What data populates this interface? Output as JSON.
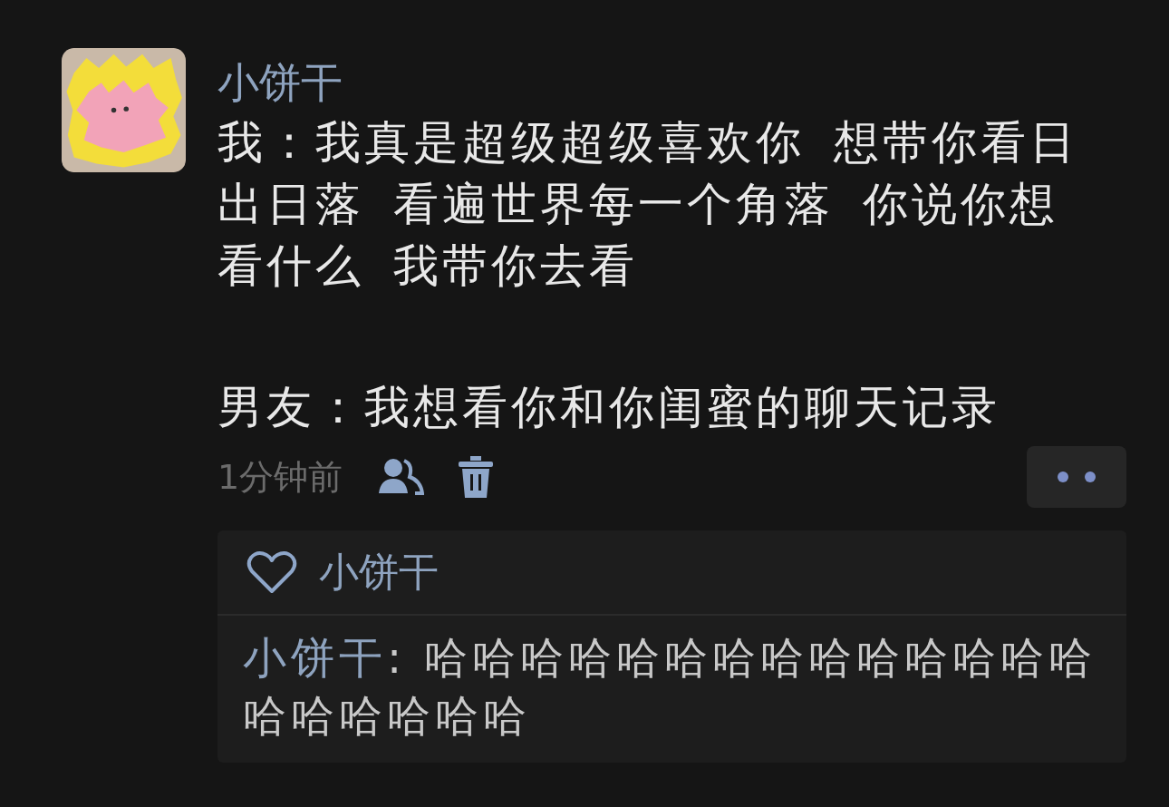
{
  "post": {
    "author": "小饼干",
    "paragraphs": [
      "我：我真是超级超级喜欢你 想带你看日出日落 看遍世界每一个角落 你说你想看什么 我带你去看",
      "男友：我想看你和你闺蜜的聊天记录"
    ],
    "time": "1分钟前"
  },
  "likes": {
    "names": [
      "小饼干"
    ]
  },
  "comments": [
    {
      "author": "小饼干",
      "separator": ":",
      "text": "哈哈哈哈哈哈哈哈哈哈哈哈哈哈哈哈哈哈哈哈"
    }
  ]
}
